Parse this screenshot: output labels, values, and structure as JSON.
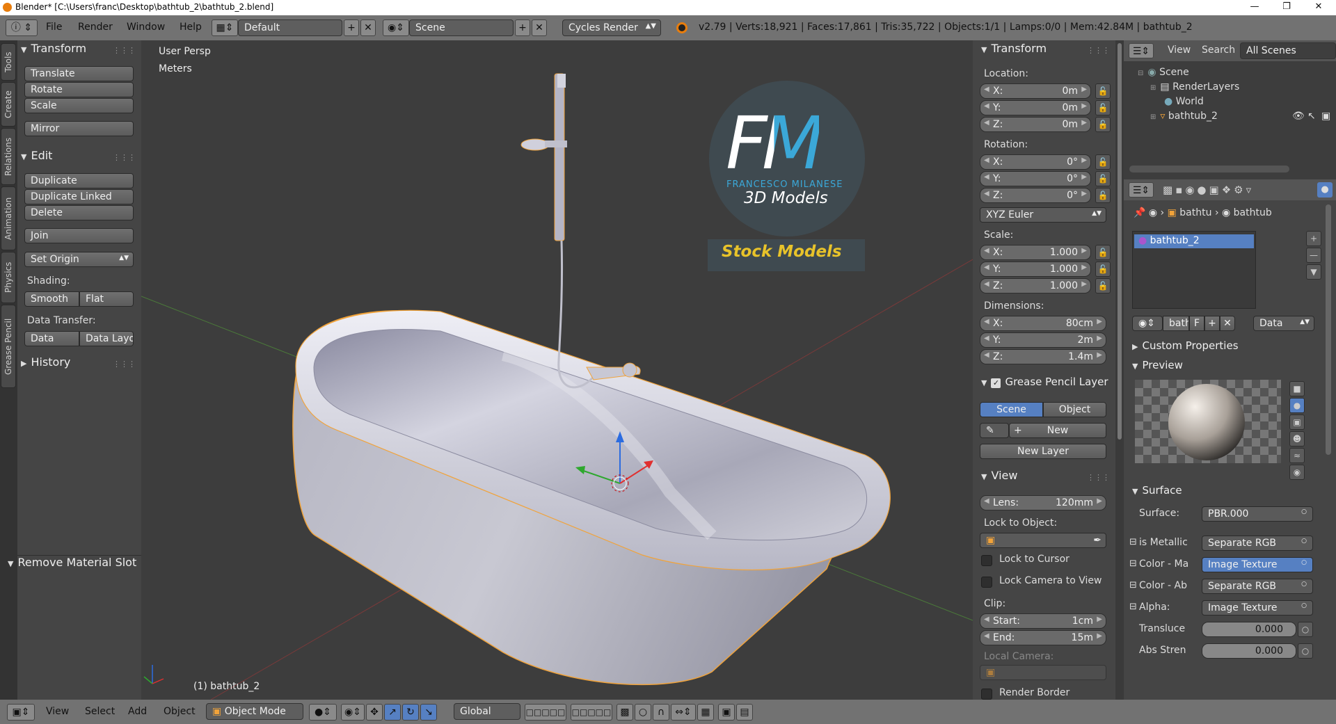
{
  "titlebar": {
    "title": "Blender* [C:\\Users\\franc\\Desktop\\bathtub_2\\bathtub_2.blend]"
  },
  "menu": {
    "file": "File",
    "render": "Render",
    "window": "Window",
    "help": "Help"
  },
  "header": {
    "screen_layout": "Default",
    "scene": "Scene",
    "engine": "Cycles Render",
    "stats": "v2.79 | Verts:18,921 | Faces:17,861 | Tris:35,722 | Objects:1/1 | Lamps:0/0 | Mem:42.84M | bathtub_2"
  },
  "tabs": [
    "Tools",
    "Create",
    "Relations",
    "Animation",
    "Physics",
    "Grease Pencil"
  ],
  "toolshelf": {
    "transform": {
      "title": "Transform",
      "translate": "Translate",
      "rotate": "Rotate",
      "scale": "Scale",
      "mirror": "Mirror"
    },
    "edit": {
      "title": "Edit",
      "duplicate": "Duplicate",
      "duplicate_linked": "Duplicate Linked",
      "delete": "Delete",
      "join": "Join",
      "set_origin": "Set Origin"
    },
    "shading": {
      "label": "Shading:",
      "smooth": "Smooth",
      "flat": "Flat"
    },
    "data_transfer": {
      "label": "Data Transfer:",
      "data": "Data",
      "data_layout": "Data Layo"
    },
    "history": "History",
    "operator": "Remove Material Slot"
  },
  "viewport": {
    "view_name": "User Persp",
    "units": "Meters",
    "object_label": "(1) bathtub_2",
    "logo": {
      "initials": "FM",
      "name": "FRANCESCO MILANESE",
      "sub": "3D Models",
      "banner": "Stock Models"
    }
  },
  "npanel": {
    "transform_title": "Transform",
    "location_label": "Location:",
    "location": [
      {
        "k": "X:",
        "v": "0m"
      },
      {
        "k": "Y:",
        "v": "0m"
      },
      {
        "k": "Z:",
        "v": "0m"
      }
    ],
    "rotation_label": "Rotation:",
    "rotation": [
      {
        "k": "X:",
        "v": "0°"
      },
      {
        "k": "Y:",
        "v": "0°"
      },
      {
        "k": "Z:",
        "v": "0°"
      }
    ],
    "rotation_mode": "XYZ Euler",
    "scale_label": "Scale:",
    "scale": [
      {
        "k": "X:",
        "v": "1.000"
      },
      {
        "k": "Y:",
        "v": "1.000"
      },
      {
        "k": "Z:",
        "v": "1.000"
      }
    ],
    "dimensions_label": "Dimensions:",
    "dimensions": [
      {
        "k": "X:",
        "v": "80cm"
      },
      {
        "k": "Y:",
        "v": "2m"
      },
      {
        "k": "Z:",
        "v": "1.4m"
      }
    ],
    "grease_title": "Grease Pencil Layer",
    "gp_scene": "Scene",
    "gp_object": "Object",
    "gp_new": "New",
    "gp_new_layer": "New Layer",
    "view_title": "View",
    "lens_k": "Lens:",
    "lens_v": "120mm",
    "lock_to_object": "Lock to Object:",
    "lock_to_cursor": "Lock to Cursor",
    "lock_camera": "Lock Camera to View",
    "clip_label": "Clip:",
    "clip_start_k": "Start:",
    "clip_start_v": "1cm",
    "clip_end_k": "End:",
    "clip_end_v": "15m",
    "local_camera": "Local Camera:",
    "render_border": "Render Border"
  },
  "outliner": {
    "view": "View",
    "search": "Search",
    "filter": "All Scenes",
    "items": [
      "Scene",
      "RenderLayers",
      "World",
      "bathtub_2"
    ]
  },
  "properties": {
    "crumb1": "bathtu",
    "crumb2": "bathtub",
    "slot": "bathtub_2",
    "mat_name": "batht",
    "mat_f": "F",
    "link": "Data",
    "custom_props": "Custom Properties",
    "preview": "Preview",
    "surface_title": "Surface",
    "surface": [
      {
        "k": "Surface:",
        "v": "PBR.000"
      },
      {
        "k": "is Metallic",
        "v": "Separate RGB"
      },
      {
        "k": "Color - Ma",
        "v": "Image Texture"
      },
      {
        "k": "Color - Ab",
        "v": "Separate RGB"
      },
      {
        "k": "Alpha:",
        "v": "Image Texture"
      }
    ],
    "sliders": [
      {
        "k": "Transluce",
        "v": "0.000"
      },
      {
        "k": "Abs Stren",
        "v": "0.000"
      }
    ]
  },
  "bottom": {
    "view": "View",
    "select": "Select",
    "add": "Add",
    "object": "Object",
    "mode": "Object Mode",
    "orientation": "Global"
  },
  "colors": {
    "accent": "#5680c2",
    "selection": "#f1a33a",
    "logo_blue": "#3ba8d8"
  }
}
